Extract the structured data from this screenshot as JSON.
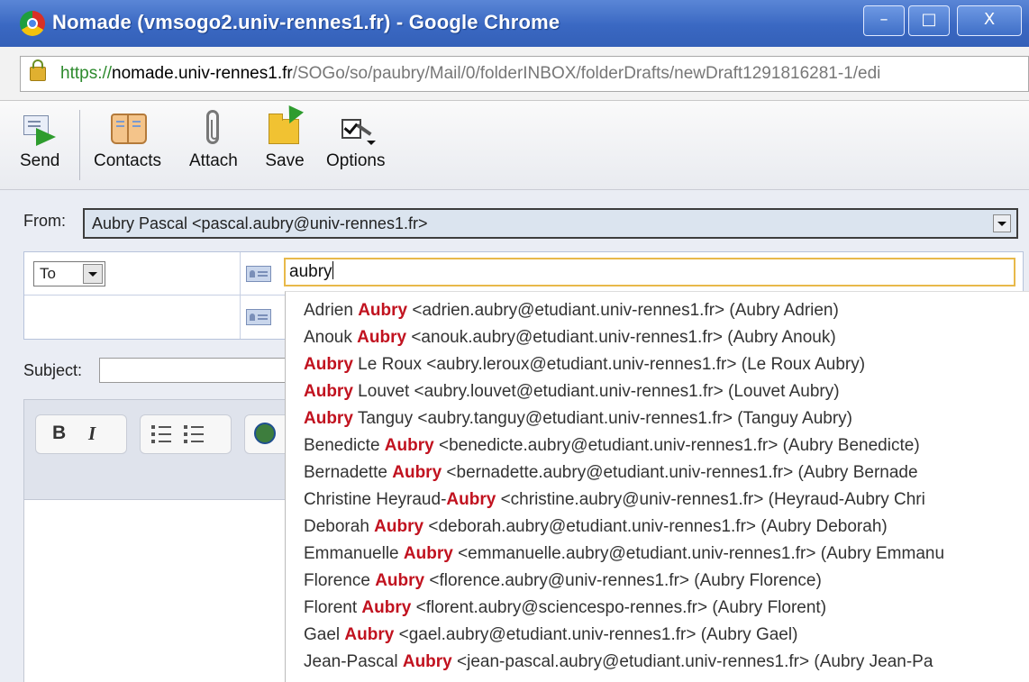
{
  "window": {
    "title": "Nomade (vmsogo2.univ-rennes1.fr) - Google Chrome",
    "min_glyph": "–",
    "max_glyph": "□",
    "close_glyph": "X"
  },
  "address": {
    "scheme": "https://",
    "host": "nomade.univ-rennes1.fr",
    "path": "/SOGo/so/paubry/Mail/0/folderINBOX/folderDrafts/newDraft1291816281-1/edi"
  },
  "toolbar": {
    "send": "Send",
    "contacts": "Contacts",
    "attach": "Attach",
    "save": "Save",
    "options": "Options"
  },
  "compose": {
    "from_label": "From:",
    "from_value": "Aubry Pascal <pascal.aubry@univ-rennes1.fr>",
    "recipient_type": "To",
    "recipient_value": "aubry",
    "subject_label": "Subject:",
    "subject_value": ""
  },
  "editor": {
    "bold": "B",
    "italic": "I"
  },
  "autocomplete": {
    "items": [
      {
        "pre": "Adrien ",
        "match": "Aubry",
        "post": " <adrien.aubry@etudiant.univ-rennes1.fr> (Aubry Adrien)"
      },
      {
        "pre": "Anouk ",
        "match": "Aubry",
        "post": " <anouk.aubry@etudiant.univ-rennes1.fr> (Aubry Anouk)"
      },
      {
        "pre": "",
        "match": "Aubry",
        "post": " Le Roux <aubry.leroux@etudiant.univ-rennes1.fr> (Le Roux Aubry)"
      },
      {
        "pre": "",
        "match": "Aubry",
        "post": " Louvet <aubry.louvet@etudiant.univ-rennes1.fr> (Louvet Aubry)"
      },
      {
        "pre": "",
        "match": "Aubry",
        "post": " Tanguy <aubry.tanguy@etudiant.univ-rennes1.fr> (Tanguy Aubry)"
      },
      {
        "pre": "Benedicte ",
        "match": "Aubry",
        "post": " <benedicte.aubry@etudiant.univ-rennes1.fr> (Aubry Benedicte)"
      },
      {
        "pre": "Bernadette ",
        "match": "Aubry",
        "post": " <bernadette.aubry@etudiant.univ-rennes1.fr> (Aubry Bernade"
      },
      {
        "pre": "Christine Heyraud-",
        "match": "Aubry",
        "post": " <christine.aubry@univ-rennes1.fr> (Heyraud-Aubry Chri"
      },
      {
        "pre": "Deborah ",
        "match": "Aubry",
        "post": " <deborah.aubry@etudiant.univ-rennes1.fr> (Aubry Deborah)"
      },
      {
        "pre": "Emmanuelle ",
        "match": "Aubry",
        "post": " <emmanuelle.aubry@etudiant.univ-rennes1.fr> (Aubry Emmanu"
      },
      {
        "pre": "Florence ",
        "match": "Aubry",
        "post": " <florence.aubry@univ-rennes1.fr> (Aubry Florence)"
      },
      {
        "pre": "Florent ",
        "match": "Aubry",
        "post": " <florent.aubry@sciencespo-rennes.fr> (Aubry Florent)"
      },
      {
        "pre": "Gael ",
        "match": "Aubry",
        "post": " <gael.aubry@etudiant.univ-rennes1.fr> (Aubry Gael)"
      },
      {
        "pre": "Jean-Pascal ",
        "match": "Aubry",
        "post": " <jean-pascal.aubry@etudiant.univ-rennes1.fr> (Aubry Jean-Pa"
      }
    ]
  },
  "colors": {
    "match_highlight": "#c1121f",
    "titlebar": "#3a68c2",
    "focus_border": "#e8b94a"
  }
}
